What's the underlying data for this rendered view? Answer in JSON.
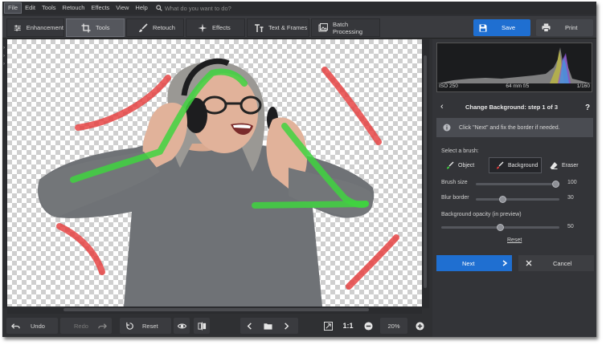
{
  "menu": {
    "items": [
      "File",
      "Edit",
      "Tools",
      "Retouch",
      "Effects",
      "View",
      "Help"
    ],
    "search_placeholder": "What do you want to do?"
  },
  "tabs": {
    "enhancement": "Enhancement",
    "tools": "Tools",
    "retouch": "Retouch",
    "effects": "Effects",
    "text_frames": "Text & Frames",
    "batch": "Batch Processing"
  },
  "actions": {
    "save": "Save",
    "print": "Print"
  },
  "histogram": {
    "iso": "ISO 250",
    "lens": "64 mm f/5",
    "shutter": "1/160"
  },
  "wizard": {
    "title": "Change Background: step 1 of 3",
    "hint": "Click \"Next\" and fix the border if needed.",
    "select_brush_label": "Select a brush:",
    "brushes": {
      "object": "Object",
      "background": "Background",
      "eraser": "Eraser"
    },
    "brush_size": {
      "label": "Brush size",
      "value": "100",
      "level": 1.0
    },
    "blur_border": {
      "label": "Blur border",
      "value": "30",
      "level": 0.3
    },
    "bg_opacity": {
      "label": "Background opacity (in preview)",
      "value": "50",
      "level": 0.5
    },
    "reset": "Reset",
    "next": "Next",
    "cancel": "Cancel"
  },
  "bottom": {
    "undo": "Undo",
    "redo": "Redo",
    "reset": "Reset",
    "ratio": "1:1",
    "zoom": "20%"
  },
  "colors": {
    "accent": "#1f6fd1",
    "object_stroke": "#3fd33f",
    "background_stroke": "#e63a3a"
  }
}
